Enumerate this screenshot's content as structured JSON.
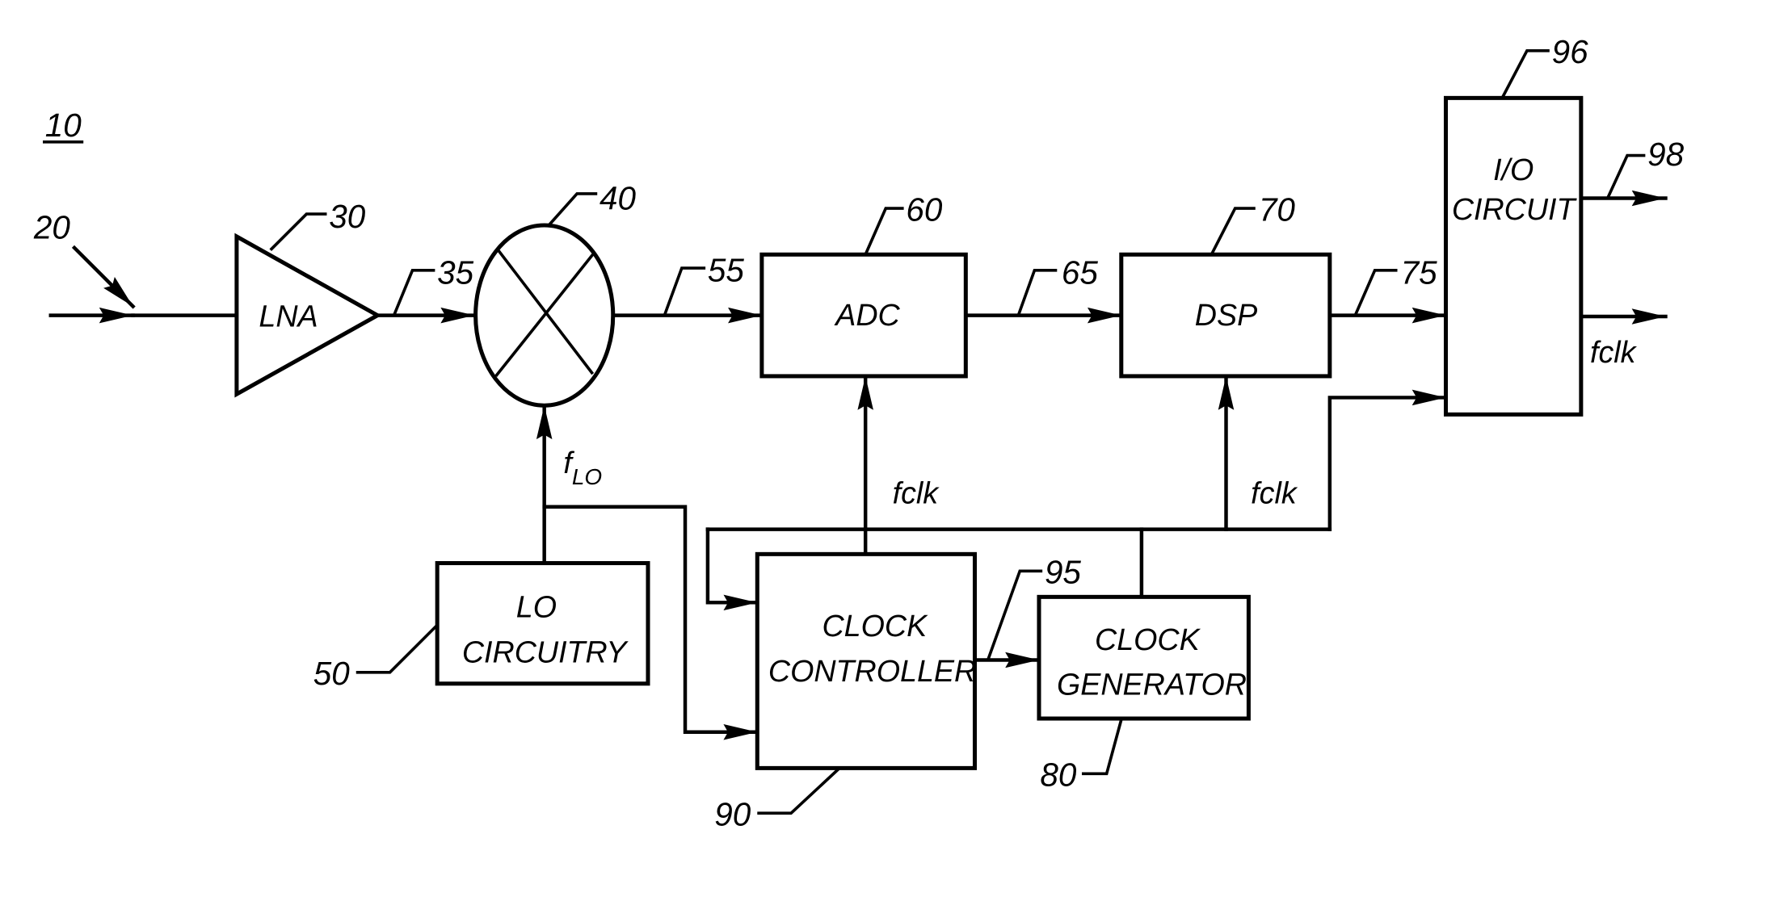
{
  "figure": {
    "figure_ref": "10",
    "input_ref": "20"
  },
  "blocks": {
    "lna": {
      "label": "LNA",
      "ref": "30"
    },
    "mixer": {
      "ref": "40"
    },
    "lo": {
      "line1": "LO",
      "line2": "CIRCUITRY",
      "ref": "50"
    },
    "adc": {
      "label": "ADC",
      "ref": "60"
    },
    "dsp": {
      "label": "DSP",
      "ref": "70"
    },
    "clock_generator": {
      "line1": "CLOCK",
      "line2": "GENERATOR",
      "ref": "80"
    },
    "clock_controller": {
      "line1": "CLOCK",
      "line2": "CONTROLLER",
      "ref": "90"
    },
    "io": {
      "line1": "I/O",
      "line2": "CIRCUIT",
      "ref": "96"
    }
  },
  "signals": {
    "lna_out_ref": "35",
    "mixer_out_ref": "55",
    "adc_out_ref": "65",
    "dsp_out_ref": "75",
    "controller_out_ref": "95",
    "io_out_ref": "98",
    "flo_main": "f",
    "flo_sub": "LO",
    "fclk_adc": "fclk",
    "fclk_dsp": "fclk",
    "fclk_out": "fclk"
  }
}
